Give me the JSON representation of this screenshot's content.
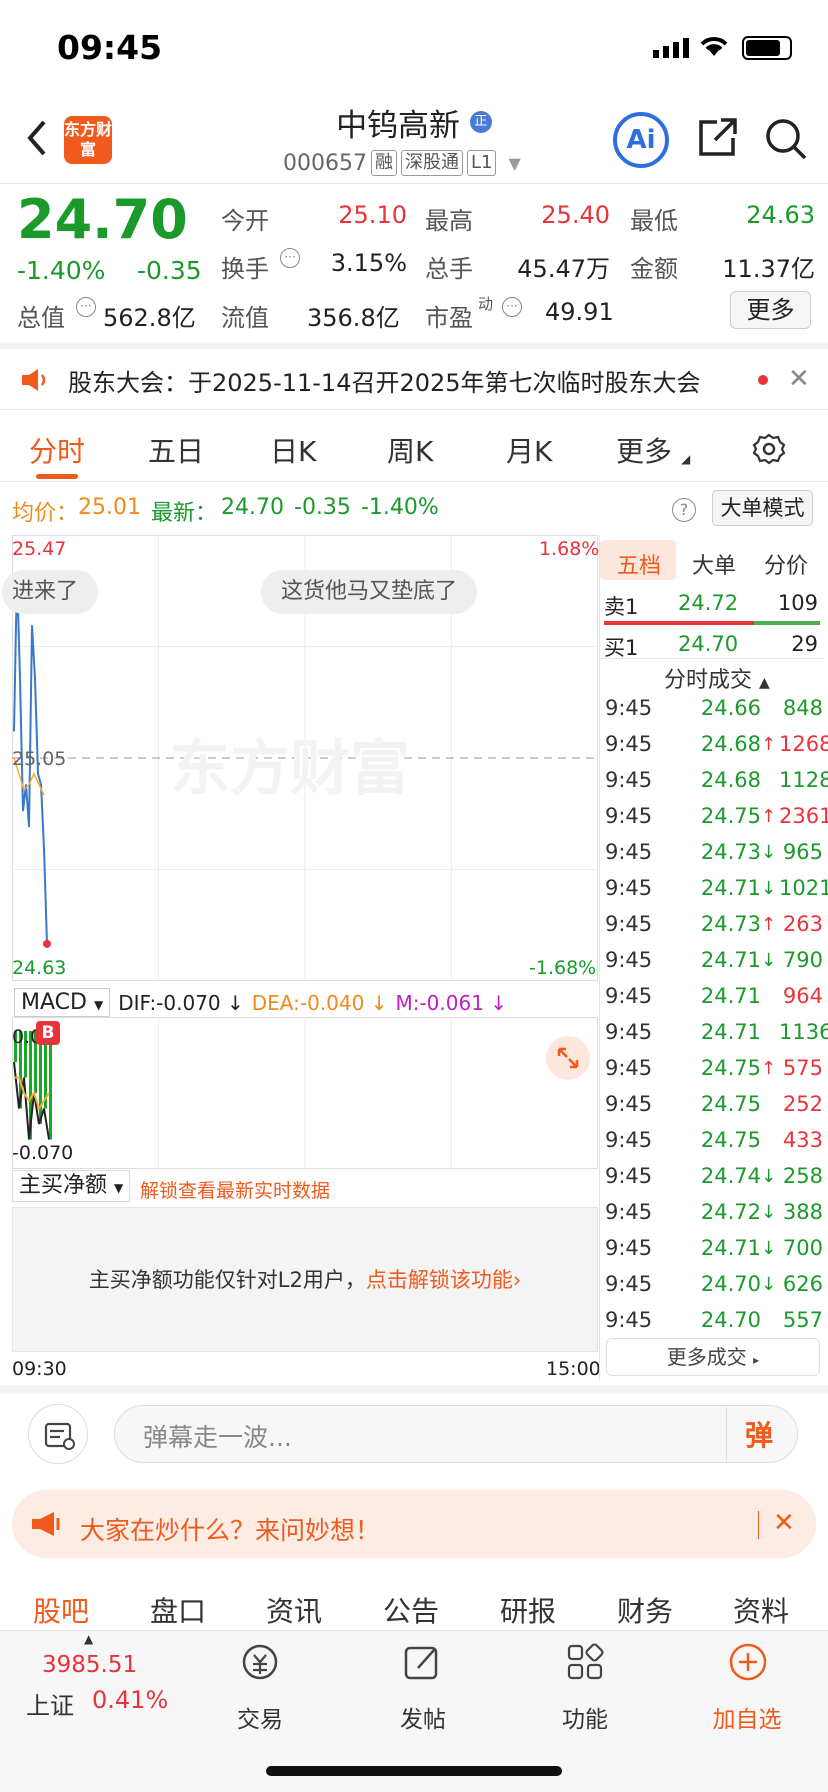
{
  "status_bar": {
    "time": "09:45"
  },
  "header": {
    "logo_text": "东方财富",
    "title": "中钨高新",
    "badge": "正",
    "code": "000657",
    "tags": [
      "融",
      "深股通",
      "L1"
    ],
    "ai_label": "Ai"
  },
  "quote": {
    "price": "24.70",
    "change_pct": "-1.40%",
    "change": "-0.35",
    "rows": [
      [
        {
          "label": "今开",
          "value": "25.10",
          "color": "red"
        },
        {
          "label": "最高",
          "value": "25.40",
          "color": "red"
        },
        {
          "label": "最低",
          "value": "24.63",
          "color": "green"
        }
      ],
      [
        {
          "label": "换手",
          "value": "3.15%",
          "color": "plain"
        },
        {
          "label": "总手",
          "value": "45.47万",
          "color": "plain"
        },
        {
          "label": "金额",
          "value": "11.37亿",
          "color": "plain"
        }
      ]
    ],
    "total_value_label": "总值",
    "total_value": "562.8亿",
    "float_label": "流值",
    "float_value": "356.8亿",
    "pe_label": "市盈",
    "pe_sup": "动",
    "pe_value": "49.91",
    "more_label": "更多"
  },
  "notice": {
    "text": "股东大会：于2025-11-14召开2025年第七次临时股东大会"
  },
  "chart_tabs": [
    "分时",
    "五日",
    "日K",
    "周K",
    "月K",
    "更多"
  ],
  "avg_row": {
    "avg_label": "均价：",
    "avg_value": "25.01",
    "latest_label": "最新：",
    "latest_value": "24.70",
    "change": "-0.35",
    "change_pct": "-1.40%",
    "big_mode": "大单模式"
  },
  "chart_data": {
    "type": "line",
    "title": "",
    "y_max_label": "25.47",
    "y_mid_label": "25.05",
    "y_min_label": "24.63",
    "pct_max_label": "1.68%",
    "pct_min_label": "-1.68%",
    "x_start": "09:30",
    "x_end": "15:00",
    "ylim": [
      24.63,
      25.47
    ],
    "price_series": {
      "name": "价格",
      "color": "#3a78c9",
      "values": [
        25.1,
        25.4,
        25.2,
        24.95,
        25.0,
        24.92,
        25.3,
        25.2,
        25.02,
        25.0,
        24.88,
        24.7
      ]
    },
    "avg_series": {
      "name": "均价",
      "color": "#f0b030",
      "values": [
        25.05,
        25.02,
        24.99,
        25.0,
        25.02,
        25.0,
        24.98
      ]
    },
    "bubbles": [
      "进来了",
      "这货他马又垫底了"
    ],
    "watermark": "东方财富",
    "macd": {
      "selector": "MACD",
      "dif": "DIF:-0.070 ↓",
      "dea": "DEA:-0.040 ↓",
      "m": "M:-0.061 ↓",
      "top_label": "0.0",
      "bottom_label": "-0.070",
      "b_marker": "B",
      "dif_values": [
        -0.02,
        -0.05,
        -0.03,
        -0.07,
        -0.04,
        -0.06,
        -0.05,
        -0.07
      ],
      "dea_values": [
        -0.03,
        -0.03,
        -0.04,
        -0.045,
        -0.04,
        -0.05,
        -0.045,
        -0.04
      ]
    }
  },
  "main_net": {
    "selector": "主买净额",
    "unlock_hint": "解锁查看最新实时数据",
    "lock_text": "主买净额功能仅针对L2用户，",
    "lock_link": "点击解锁该功能"
  },
  "right_panel": {
    "tabs": [
      "五档",
      "大单",
      "分价"
    ],
    "sell1": {
      "label": "卖1",
      "price": "24.72",
      "vol": "109"
    },
    "buy1": {
      "label": "买1",
      "price": "24.70",
      "vol": "29"
    },
    "trades_title": "分时成交",
    "trades": [
      {
        "t": "9:45",
        "p": "24.66",
        "a": "",
        "v": "848",
        "pc": "green",
        "vc": "green"
      },
      {
        "t": "9:45",
        "p": "24.68",
        "a": "↑",
        "v": "1268",
        "pc": "green",
        "vc": "red"
      },
      {
        "t": "9:45",
        "p": "24.68",
        "a": "",
        "v": "1128",
        "pc": "green",
        "vc": "green"
      },
      {
        "t": "9:45",
        "p": "24.75",
        "a": "↑",
        "v": "2361",
        "pc": "green",
        "vc": "red"
      },
      {
        "t": "9:45",
        "p": "24.73",
        "a": "↓",
        "v": "965",
        "pc": "green",
        "vc": "green"
      },
      {
        "t": "9:45",
        "p": "24.71",
        "a": "↓",
        "v": "1021",
        "pc": "green",
        "vc": "green"
      },
      {
        "t": "9:45",
        "p": "24.73",
        "a": "↑",
        "v": "263",
        "pc": "green",
        "vc": "red"
      },
      {
        "t": "9:45",
        "p": "24.71",
        "a": "↓",
        "v": "790",
        "pc": "green",
        "vc": "green"
      },
      {
        "t": "9:45",
        "p": "24.71",
        "a": "",
        "v": "964",
        "pc": "green",
        "vc": "red"
      },
      {
        "t": "9:45",
        "p": "24.71",
        "a": "",
        "v": "1136",
        "pc": "green",
        "vc": "green"
      },
      {
        "t": "9:45",
        "p": "24.75",
        "a": "↑",
        "v": "575",
        "pc": "green",
        "vc": "red"
      },
      {
        "t": "9:45",
        "p": "24.75",
        "a": "",
        "v": "252",
        "pc": "green",
        "vc": "red"
      },
      {
        "t": "9:45",
        "p": "24.75",
        "a": "",
        "v": "433",
        "pc": "green",
        "vc": "red"
      },
      {
        "t": "9:45",
        "p": "24.74",
        "a": "↓",
        "v": "258",
        "pc": "green",
        "vc": "green"
      },
      {
        "t": "9:45",
        "p": "24.72",
        "a": "↓",
        "v": "388",
        "pc": "green",
        "vc": "green"
      },
      {
        "t": "9:45",
        "p": "24.71",
        "a": "↓",
        "v": "700",
        "pc": "green",
        "vc": "green"
      },
      {
        "t": "9:45",
        "p": "24.70",
        "a": "↓",
        "v": "626",
        "pc": "green",
        "vc": "green"
      },
      {
        "t": "9:45",
        "p": "24.70",
        "a": "",
        "v": "557",
        "pc": "green",
        "vc": "green"
      }
    ],
    "more_trades": "更多成交"
  },
  "danmu": {
    "placeholder": "弹幕走一波...",
    "send_label": "弹"
  },
  "ai_banner": {
    "text": "大家在炒什么？来问妙想！"
  },
  "bottom_tabs": [
    "股吧",
    "盘口",
    "资讯",
    "公告",
    "研报",
    "财务",
    "资料"
  ],
  "bottom_bar": {
    "index_value": "3985.51",
    "index_name": "上证",
    "index_pct": "0.41%",
    "items": [
      "交易",
      "发帖",
      "功能",
      "加自选"
    ]
  },
  "colors": {
    "up": "#e8333b",
    "down": "#1a9a2a",
    "accent": "#f05a1c",
    "line": "#3a78c9",
    "avg": "#f0b030"
  }
}
